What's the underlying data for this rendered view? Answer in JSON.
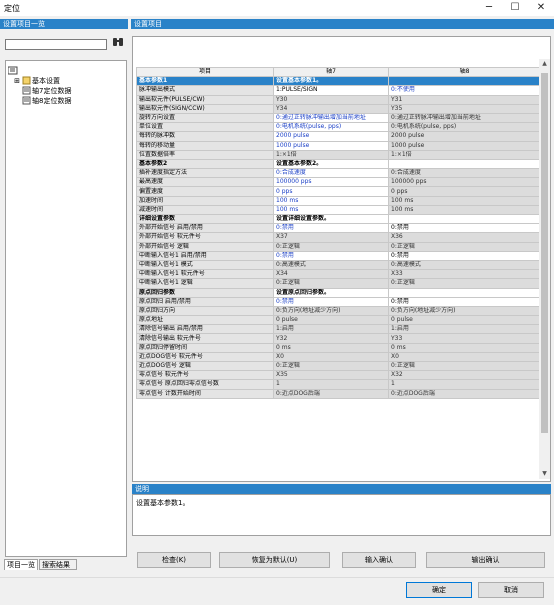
{
  "window": {
    "title": "定位",
    "minimize": "─",
    "maximize": "☐",
    "close": "✕"
  },
  "left_panel": {
    "header": "设置项目一览",
    "search_value": "",
    "tree_root": "",
    "tree_items": [
      "基本设置",
      "轴7定位数据",
      "轴8定位数据"
    ],
    "tabs": [
      "项目一览",
      "搜索结果"
    ]
  },
  "right_panel": {
    "header": "设置项目",
    "columns": [
      "项目",
      "轴7",
      "轴8"
    ],
    "rows": [
      {
        "kind": "cat",
        "sel": true,
        "name": "基本参数1",
        "a": "设置基本参数1。",
        "b": ""
      },
      {
        "kind": "p",
        "name": "脉冲输出模式",
        "a": "1:PULSE/SIGN",
        "b": "0:不使用",
        "as": "white",
        "bs": "white blue"
      },
      {
        "kind": "p",
        "name": "输出软元件(PULSE/CW)",
        "a": "Y30",
        "b": "Y31",
        "as": "gray",
        "bs": "gray"
      },
      {
        "kind": "p",
        "name": "输出软元件(SIGN/CCW)",
        "a": "Y34",
        "b": "Y35",
        "as": "gray",
        "bs": "gray"
      },
      {
        "kind": "p",
        "name": "旋转方向设置",
        "a": "0:通过正转脉冲输出增加当前地址",
        "b": "0:通过正转脉冲输出增加当前地址",
        "as": "white blue",
        "bs": "gray"
      },
      {
        "kind": "p",
        "name": "单位设置",
        "a": "0:电机系统(pulse, pps)",
        "b": "0:电机系统(pulse, pps)",
        "as": "white blue",
        "bs": "gray"
      },
      {
        "kind": "p",
        "name": "每转的脉冲数",
        "a": "2000 pulse",
        "b": "2000 pulse",
        "as": "white blue",
        "bs": "gray"
      },
      {
        "kind": "p",
        "name": "每转的移动量",
        "a": "1000 pulse",
        "b": "1000 pulse",
        "as": "white blue",
        "bs": "gray"
      },
      {
        "kind": "p",
        "name": "位置数据倍率",
        "a": "1:×1倍",
        "b": "1:×1倍",
        "as": "gray",
        "bs": "gray"
      },
      {
        "kind": "cat",
        "name": "基本参数2",
        "a": "设置基本参数2。",
        "b": ""
      },
      {
        "kind": "p",
        "name": "插补速度指定方法",
        "a": "0:合成速度",
        "b": "0:合成速度",
        "as": "white blue",
        "bs": "gray"
      },
      {
        "kind": "p",
        "name": "最高速度",
        "a": "100000 pps",
        "b": "100000 pps",
        "as": "white blue",
        "bs": "gray"
      },
      {
        "kind": "p",
        "name": "偏置速度",
        "a": "0 pps",
        "b": "0 pps",
        "as": "white blue",
        "bs": "gray"
      },
      {
        "kind": "p",
        "name": "加速时间",
        "a": "100 ms",
        "b": "100 ms",
        "as": "white blue",
        "bs": "gray"
      },
      {
        "kind": "p",
        "name": "减速时间",
        "a": "100 ms",
        "b": "100 ms",
        "as": "white blue",
        "bs": "gray"
      },
      {
        "kind": "cat",
        "name": "详细设置参数",
        "a": "设置详细设置参数。",
        "b": ""
      },
      {
        "kind": "p",
        "name": "外部开始信号 启用/禁用",
        "a": "0:禁用",
        "b": "0:禁用",
        "as": "white blue",
        "bs": "white"
      },
      {
        "kind": "p",
        "name": "外部开始信号 软元件号",
        "a": "X37",
        "b": "X36",
        "as": "gray",
        "bs": "gray"
      },
      {
        "kind": "p",
        "name": "外部开始信号 逻辑",
        "a": "0:正逻辑",
        "b": "0:正逻辑",
        "as": "gray",
        "bs": "gray"
      },
      {
        "kind": "p",
        "name": "中断输入信号1 启用/禁用",
        "a": "0:禁用",
        "b": "0:禁用",
        "as": "white blue",
        "bs": "white"
      },
      {
        "kind": "p",
        "name": "中断输入信号1 模式",
        "a": "0:高速模式",
        "b": "0:高速模式",
        "as": "gray",
        "bs": "gray"
      },
      {
        "kind": "p",
        "name": "中断输入信号1 软元件号",
        "a": "X34",
        "b": "X33",
        "as": "gray",
        "bs": "gray"
      },
      {
        "kind": "p",
        "name": "中断输入信号1 逻辑",
        "a": "0:正逻辑",
        "b": "0:正逻辑",
        "as": "gray",
        "bs": "gray"
      },
      {
        "kind": "cat",
        "name": "原点回归参数",
        "a": "设置原点回归参数。",
        "b": ""
      },
      {
        "kind": "p",
        "name": "原点回归 启用/禁用",
        "a": "0:禁用",
        "b": "0:禁用",
        "as": "white blue",
        "bs": "white"
      },
      {
        "kind": "p",
        "name": "原点回归方向",
        "a": "0:负方向(地址减少方向)",
        "b": "0:负方向(地址减少方向)",
        "as": "gray",
        "bs": "gray"
      },
      {
        "kind": "p",
        "name": "原点地址",
        "a": "0 pulse",
        "b": "0 pulse",
        "as": "gray",
        "bs": "gray"
      },
      {
        "kind": "p",
        "name": "清除信号输出 启用/禁用",
        "a": "1:启用",
        "b": "1:启用",
        "as": "gray",
        "bs": "gray"
      },
      {
        "kind": "p",
        "name": "清除信号输出 软元件号",
        "a": "Y32",
        "b": "Y33",
        "as": "gray",
        "bs": "gray"
      },
      {
        "kind": "p",
        "name": "原点回归停留时间",
        "a": "0 ms",
        "b": "0 ms",
        "as": "gray",
        "bs": "gray"
      },
      {
        "kind": "p",
        "name": "近点DOG信号 软元件号",
        "a": "X0",
        "b": "X0",
        "as": "gray",
        "bs": "gray"
      },
      {
        "kind": "p",
        "name": "近点DOG信号 逻辑",
        "a": "0:正逻辑",
        "b": "0:正逻辑",
        "as": "gray",
        "bs": "gray"
      },
      {
        "kind": "p",
        "name": "零点信号 软元件号",
        "a": "X35",
        "b": "X32",
        "as": "gray",
        "bs": "gray"
      },
      {
        "kind": "p",
        "name": "零点信号 原点回归零点信号数",
        "a": "1",
        "b": "1",
        "as": "gray",
        "bs": "gray"
      },
      {
        "kind": "p",
        "name": "零点信号 计数开始时间",
        "a": "0:近点DOG后端",
        "b": "0:近点DOG后端",
        "as": "gray",
        "bs": "gray"
      }
    ]
  },
  "description": {
    "header": "说明",
    "text": "设置基本参数1。"
  },
  "buttons": {
    "check": "检查(K)",
    "restore": "恢复为默认(U)",
    "input_confirm": "输入确认",
    "output_confirm": "输出确认",
    "ok": "确定",
    "cancel": "取消"
  }
}
